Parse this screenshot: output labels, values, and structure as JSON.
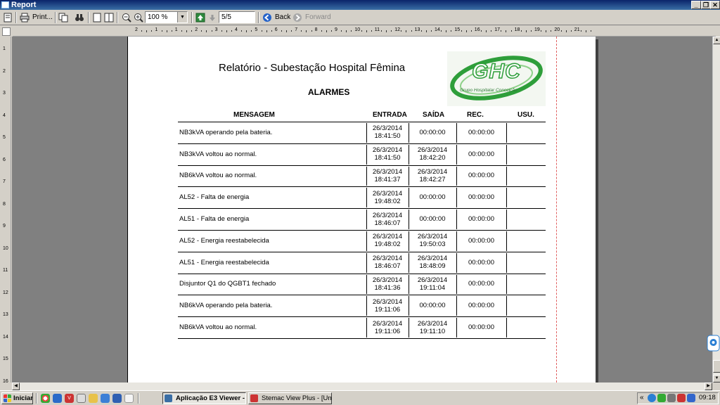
{
  "window": {
    "title": "Report",
    "min_glyph": "_",
    "restore_glyph": "❐",
    "close_glyph": "✕"
  },
  "toolbar": {
    "print_label": "Print...",
    "zoom_value": "100 %",
    "page_value": "5/5",
    "back_label": "Back",
    "forward_label": "Forward"
  },
  "ruler": {
    "h_labels": [
      "2",
      "1",
      "1",
      "2",
      "3",
      "4",
      "5",
      "6",
      "7",
      "8",
      "9",
      "10",
      "11",
      "12",
      "13",
      "14",
      "15",
      "16",
      "17",
      "18",
      "19",
      "20",
      "21"
    ],
    "v_labels": [
      "1",
      "2",
      "3",
      "4",
      "5",
      "6",
      "7",
      "8",
      "9",
      "10",
      "11",
      "12",
      "13",
      "14",
      "15",
      "16"
    ]
  },
  "report": {
    "title": "Relatório - Subestação Hospital Fêmina",
    "subtitle": "ALARMES",
    "logo_text": "GHC",
    "logo_sub": "Grupo Hospitalar Conceição",
    "columns": [
      "MENSAGEM",
      "ENTRADA",
      "SAÍDA",
      "REC.",
      "USU."
    ],
    "rows": [
      {
        "msg": "NB3kVA operando pela bateria.",
        "in_d": "26/3/2014",
        "in_t": "18:41:50",
        "out_d": "",
        "out_t": "00:00:00",
        "rec": "00:00:00",
        "usu": ""
      },
      {
        "msg": "NB3kVA voltou ao normal.",
        "in_d": "26/3/2014",
        "in_t": "18:41:50",
        "out_d": "26/3/2014",
        "out_t": "18:42:20",
        "rec": "00:00:00",
        "usu": ""
      },
      {
        "msg": "NB6kVA voltou ao normal.",
        "in_d": "26/3/2014",
        "in_t": "18:41:37",
        "out_d": "26/3/2014",
        "out_t": "18:42:27",
        "rec": "00:00:00",
        "usu": ""
      },
      {
        "msg": "AL52 - Falta de energia",
        "in_d": "26/3/2014",
        "in_t": "19:48:02",
        "out_d": "",
        "out_t": "00:00:00",
        "rec": "00:00:00",
        "usu": ""
      },
      {
        "msg": "AL51 - Falta de energia",
        "in_d": "26/3/2014",
        "in_t": "18:46:07",
        "out_d": "",
        "out_t": "00:00:00",
        "rec": "00:00:00",
        "usu": ""
      },
      {
        "msg": "AL52 - Energia reestabelecida",
        "in_d": "26/3/2014",
        "in_t": "19:48:02",
        "out_d": "26/3/2014",
        "out_t": "19:50:03",
        "rec": "00:00:00",
        "usu": ""
      },
      {
        "msg": "AL51 - Energia reestabelecida",
        "in_d": "26/3/2014",
        "in_t": "18:46:07",
        "out_d": "26/3/2014",
        "out_t": "18:48:09",
        "rec": "00:00:00",
        "usu": ""
      },
      {
        "msg": "Disjuntor Q1 do QGBT1 fechado",
        "in_d": "26/3/2014",
        "in_t": "18:41:36",
        "out_d": "26/3/2014",
        "out_t": "19:11:04",
        "rec": "00:00:00",
        "usu": ""
      },
      {
        "msg": "NB6kVA operando pela bateria.",
        "in_d": "26/3/2014",
        "in_t": "19:11:06",
        "out_d": "",
        "out_t": "00:00:00",
        "rec": "00:00:00",
        "usu": ""
      },
      {
        "msg": "NB6kVA voltou ao normal.",
        "in_d": "26/3/2014",
        "in_t": "19:11:06",
        "out_d": "26/3/2014",
        "out_t": "19:11:10",
        "rec": "00:00:00",
        "usu": ""
      }
    ]
  },
  "taskbar": {
    "start_label": "Iniciar",
    "tasks": [
      "Aplicação E3 Viewer - ...",
      "Stemac View Plus - [Unifil..."
    ],
    "clock": "09:18",
    "tray_chevron": "«"
  },
  "colors": {
    "title_bar": "#0a246a",
    "logo_green": "#2e9e3a",
    "margin_line": "#e06060"
  }
}
